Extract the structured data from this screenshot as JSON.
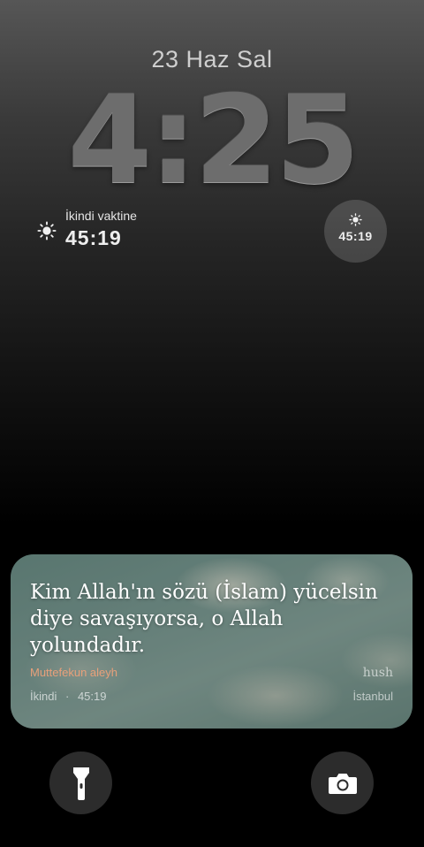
{
  "lockscreen": {
    "date": "23 Haz Sal",
    "time": "4:25"
  },
  "widgets": {
    "prayer_left": {
      "icon": "sun-icon",
      "label": "İkindi vaktine",
      "value": "45:19"
    },
    "prayer_circle": {
      "icon": "sun-icon",
      "value": "45:19"
    }
  },
  "notification": {
    "quote": "Kim Allah'ın sözü (İslam) yücelsin diye savaşıyorsa, o Allah yolundadır.",
    "source": "Muttefekun aleyh",
    "brand": "hush",
    "prayer_name": "İkindi",
    "separator": "·",
    "countdown": "45:19",
    "city": "İstanbul",
    "source_color": "#e8a07a"
  },
  "controls": {
    "flashlight_icon": "flashlight-icon",
    "camera_icon": "camera-icon"
  }
}
